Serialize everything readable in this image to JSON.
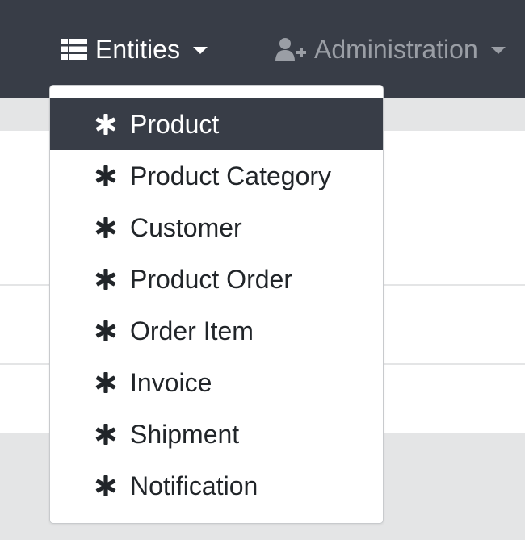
{
  "navbar": {
    "entities_label": "Entities",
    "administration_label": "Administration"
  },
  "menu": {
    "items": [
      {
        "label": "Product",
        "active": true
      },
      {
        "label": "Product Category",
        "active": false
      },
      {
        "label": "Customer",
        "active": false
      },
      {
        "label": "Product Order",
        "active": false
      },
      {
        "label": "Order Item",
        "active": false
      },
      {
        "label": "Invoice",
        "active": false
      },
      {
        "label": "Shipment",
        "active": false
      },
      {
        "label": "Notification",
        "active": false
      }
    ]
  },
  "icons": {
    "entities": "list-icon",
    "administration": "user-plus-icon",
    "menu_item": "asterisk-icon",
    "dropdown_toggle": "caret-down-icon"
  },
  "colors": {
    "navbar_bg": "#383d47",
    "active_item_bg": "#383d47",
    "nav_muted_text": "#9a9ea5",
    "page_bg": "#e4e5e6",
    "menu_text": "#212529"
  }
}
